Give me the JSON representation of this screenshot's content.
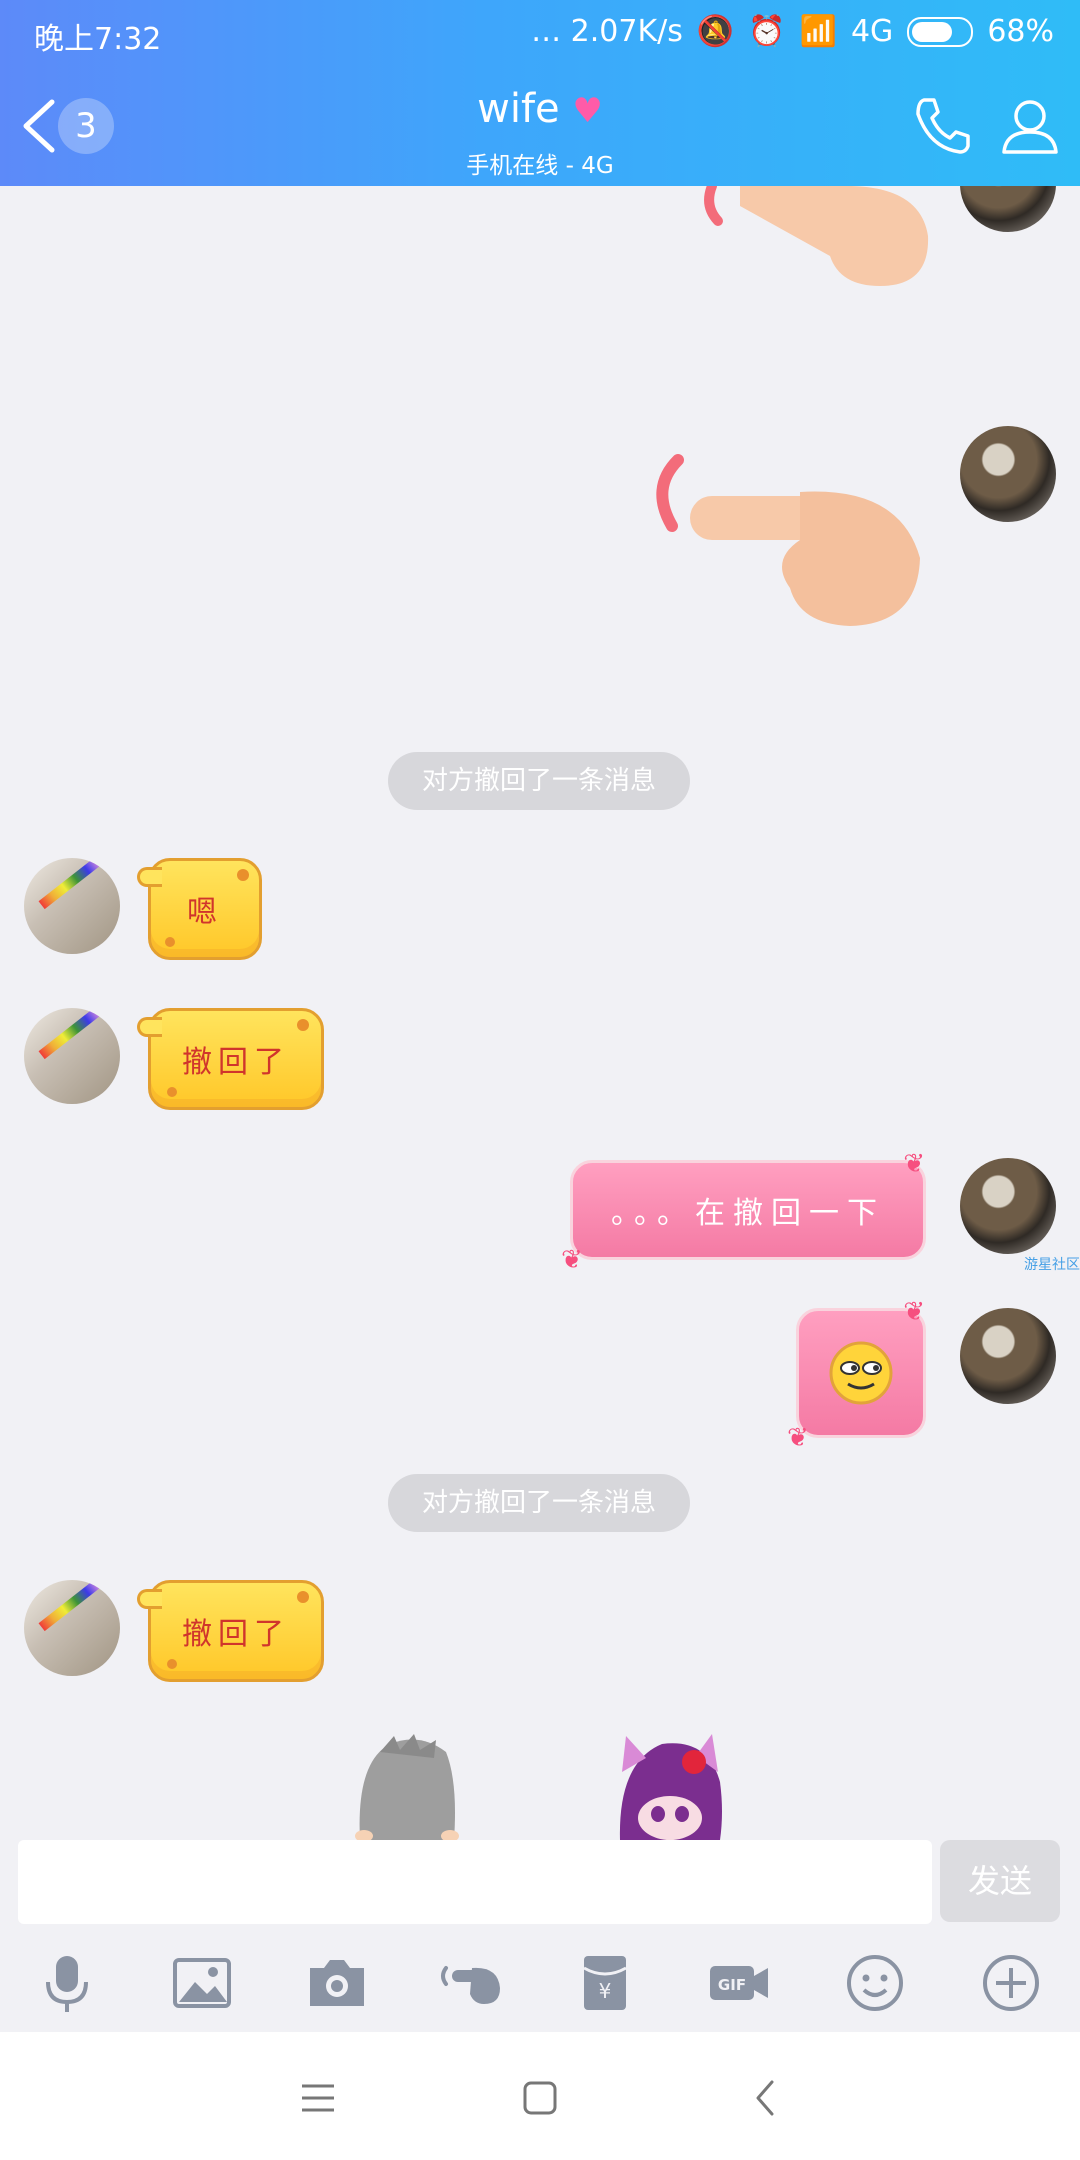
{
  "status_bar": {
    "time": "晚上7:32",
    "network_speed": "… 2.07K/s",
    "network_type": "4G",
    "battery": "68%"
  },
  "header": {
    "back_count": "3",
    "title": "wife",
    "subtitle": "手机在线 - 4G"
  },
  "messages": {
    "notice_1": "对方撤回了一条消息",
    "msg_en": "嗯",
    "msg_recall_1": "撤回了",
    "msg_self_text": "。。。在撤回一下",
    "notice_2": "对方撤回了一条消息",
    "msg_recall_2": "撤回了"
  },
  "watermark": "游星社区",
  "input": {
    "value": "",
    "send_label": "发送"
  },
  "colors": {
    "header_start": "#5d8af9",
    "header_end": "#2fbcf7",
    "chat_bg": "#f1f1f5",
    "cheese_bubble": "#ffd43a",
    "pink_bubble": "#f78aae"
  }
}
